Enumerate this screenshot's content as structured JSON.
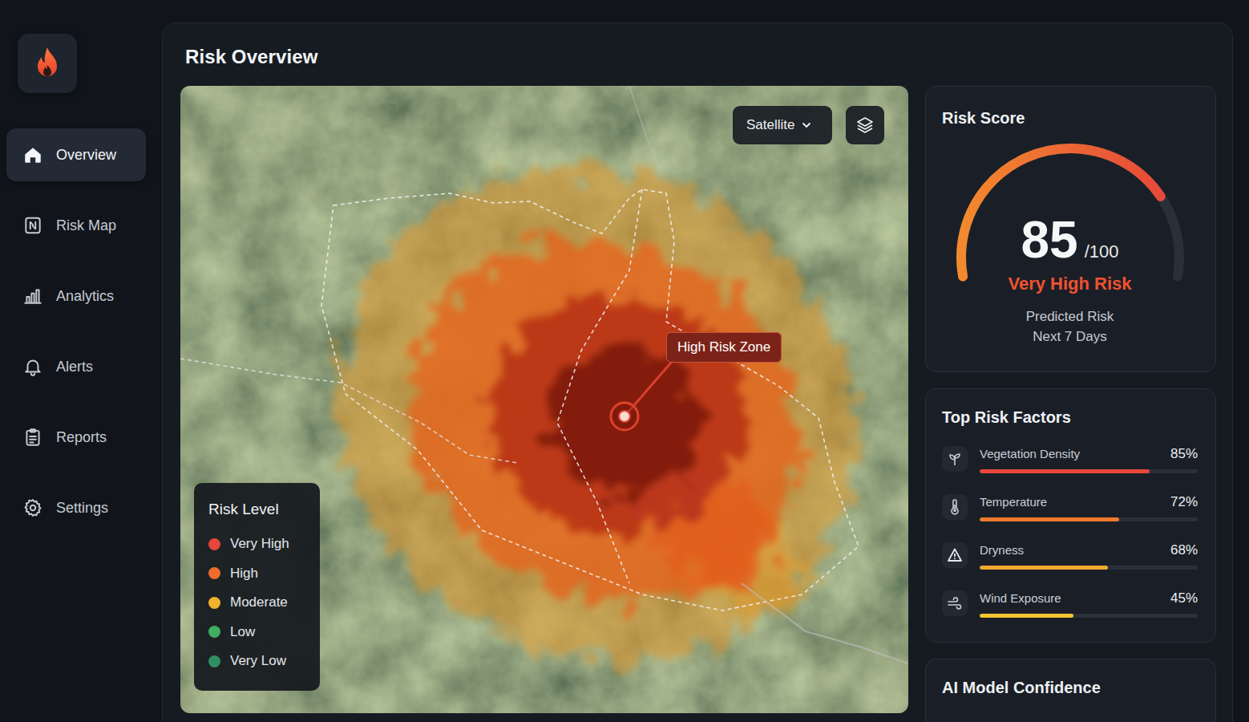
{
  "sidebar": {
    "items": [
      {
        "label": "Overview",
        "selected": true
      },
      {
        "label": "Risk Map",
        "selected": false
      },
      {
        "label": "Analytics",
        "selected": false
      },
      {
        "label": "Alerts",
        "selected": false
      },
      {
        "label": "Reports",
        "selected": false
      },
      {
        "label": "Settings",
        "selected": false
      }
    ]
  },
  "page": {
    "title": "Risk Overview"
  },
  "map": {
    "view_select": "Satellite",
    "tooltip": "High Risk Zone",
    "legend": {
      "title": "Risk Level",
      "items": [
        {
          "label": "Very High",
          "color": "#e5473a"
        },
        {
          "label": "High",
          "color": "#ee6b2d"
        },
        {
          "label": "Moderate",
          "color": "#f0b12c"
        },
        {
          "label": "Low",
          "color": "#3fae5e"
        },
        {
          "label": "Very Low",
          "color": "#2f8f62"
        }
      ]
    }
  },
  "risk_score": {
    "title": "Risk Score",
    "value": "85",
    "max": "/100",
    "label": "Very High Risk",
    "caption_lines": [
      "Predicted Risk",
      "Next 7 Days"
    ],
    "level": 0.78
  },
  "risk_factors": {
    "title": "Top Risk Factors",
    "items": [
      {
        "name": "Vegetation Density",
        "value": "85%",
        "level": 0.78,
        "color": "#e9463a"
      },
      {
        "name": "Temperature",
        "value": "72%",
        "level": 0.64,
        "color": "#ef7b2e"
      },
      {
        "name": "Dryness",
        "value": "68%",
        "level": 0.59,
        "color": "#f0a92e"
      },
      {
        "name": "Wind Exposure",
        "value": "45%",
        "level": 0.43,
        "color": "#f2c431"
      }
    ]
  },
  "confidence": {
    "title": "AI Model Confidence"
  }
}
